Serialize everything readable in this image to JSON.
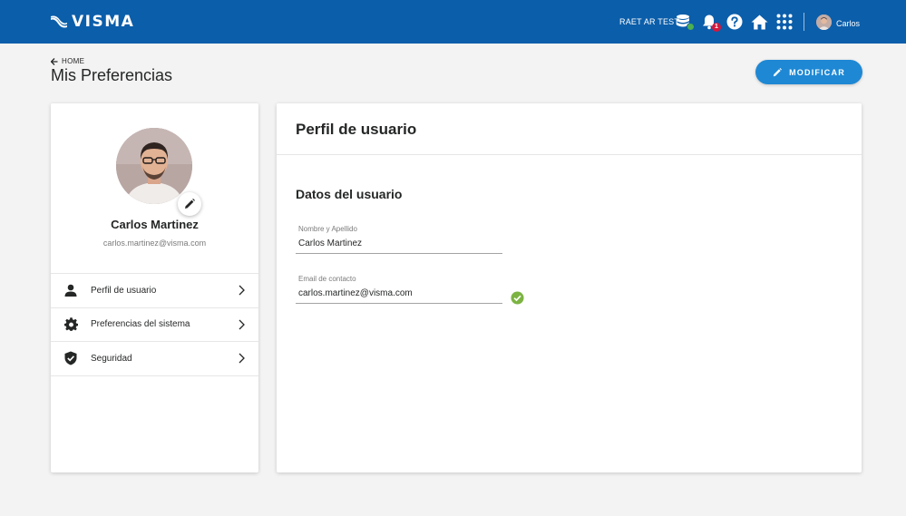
{
  "topbar": {
    "brand": "VISMA",
    "environment": "RAET AR TEST",
    "notification_count": "1",
    "username": "Carlos",
    "icons": [
      "database-icon",
      "bell-icon",
      "help-icon",
      "home-icon",
      "apps-grid-icon"
    ]
  },
  "header": {
    "breadcrumb": "HOME",
    "title": "Mis Preferencias",
    "modify_label": "MODIFICAR"
  },
  "profile": {
    "name": "Carlos Martinez",
    "email": "carlos.martinez@visma.com"
  },
  "menu": {
    "items": [
      {
        "label": "Perfil de usuario",
        "icon": "person-icon"
      },
      {
        "label": "Preferencias del sistema",
        "icon": "gear-icon"
      },
      {
        "label": "Seguridad",
        "icon": "shield-icon"
      }
    ]
  },
  "panel": {
    "title": "Perfil de usuario",
    "section_title": "Datos del usuario",
    "fields": [
      {
        "label": "Nombre y Apellido",
        "value": "Carlos Martinez"
      },
      {
        "label": "Email de contacto",
        "value": "carlos.martinez@visma.com"
      }
    ]
  },
  "colors": {
    "topbar": "#0b5eaa",
    "primary_button": "#1e88d4",
    "valid": "#7cb342",
    "badge": "#d4183d"
  }
}
